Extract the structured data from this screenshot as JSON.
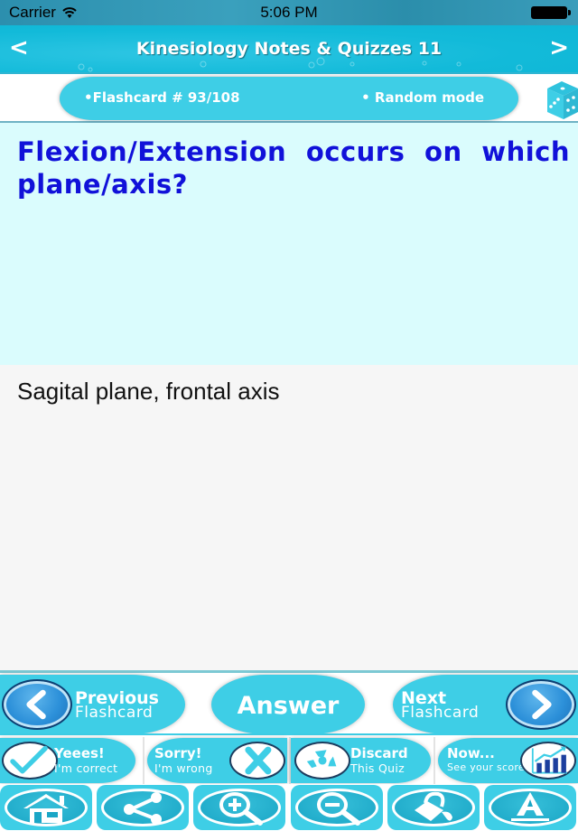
{
  "status_bar": {
    "carrier": "Carrier",
    "time": "5:06 PM",
    "wifi_icon": "wifi-icon",
    "battery_icon": "battery-full-icon"
  },
  "nav": {
    "title": "Kinesiology Notes & Quizzes 11",
    "prev_symbol": "<",
    "next_symbol": ">"
  },
  "info": {
    "flashcard_label": "•Flashcard #  93/108",
    "mode_label": "• Random mode",
    "dice_icon": "dice-icon"
  },
  "card": {
    "question": "Flexion/Extension occurs on which plane/axis?",
    "answer": "Sagital plane, frontal axis",
    "question_color": "#1111d9"
  },
  "controls": {
    "previous": {
      "title": "Previous",
      "subtitle": "Flashcard",
      "icon": "chevron-left-icon"
    },
    "answer": {
      "label": "Answer"
    },
    "next": {
      "title": "Next",
      "subtitle": "Flashcard",
      "icon": "chevron-right-icon"
    },
    "correct": {
      "title": "Yeees!",
      "subtitle": "I'm correct",
      "icon": "checkmark-icon"
    },
    "wrong": {
      "title": "Sorry!",
      "subtitle": "I'm wrong",
      "icon": "x-icon"
    },
    "discard": {
      "title": "Discard",
      "subtitle": "This Quiz",
      "icon": "recycle-icon"
    },
    "score": {
      "title": "Now...",
      "subtitle": "See your score",
      "icon": "bar-chart-icon"
    }
  },
  "toolbar": {
    "items": [
      {
        "name": "home",
        "icon": "home-icon"
      },
      {
        "name": "share",
        "icon": "share-icon"
      },
      {
        "name": "zoom-in",
        "icon": "zoom-in-icon"
      },
      {
        "name": "zoom-out",
        "icon": "zoom-out-icon"
      },
      {
        "name": "background-color",
        "icon": "paint-bucket-icon"
      },
      {
        "name": "font",
        "icon": "font-icon"
      }
    ]
  },
  "colors": {
    "accent": "#3ecee6",
    "nav_bg": "#12bad9",
    "question_bg": "#dafcfd",
    "answer_bg": "#f6f6f6"
  }
}
